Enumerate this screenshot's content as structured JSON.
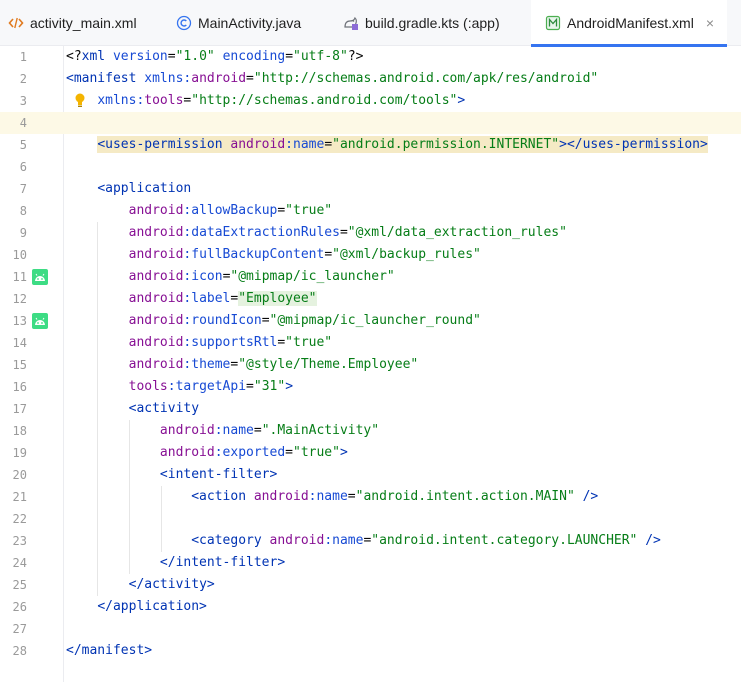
{
  "tabs": [
    {
      "label": "activity_main.xml",
      "icon": "xml-file-icon",
      "active": false
    },
    {
      "label": "MainActivity.java",
      "icon": "java-class-icon",
      "active": false
    },
    {
      "label": "build.gradle.kts (:app)",
      "icon": "gradle-file-icon",
      "active": false
    },
    {
      "label": "AndroidManifest.xml",
      "icon": "manifest-file-icon",
      "active": true
    }
  ],
  "close_glyph": "×",
  "editor": {
    "line_numbers": [
      "1",
      "2",
      "3",
      "4",
      "5",
      "6",
      "7",
      "8",
      "9",
      "10",
      "11",
      "12",
      "13",
      "14",
      "15",
      "16",
      "17",
      "18",
      "19",
      "20",
      "21",
      "22",
      "23",
      "24",
      "25",
      "26",
      "27",
      "28"
    ],
    "lines": [
      "<?xml version=\"1.0\" encoding=\"utf-8\"?>",
      "<manifest xmlns:android=\"http://schemas.android.com/apk/res/android\"",
      "    xmlns:tools=\"http://schemas.android.com/tools\">",
      "",
      "    <uses-permission android:name=\"android.permission.INTERNET\"></uses-permission>",
      "",
      "    <application",
      "        android:allowBackup=\"true\"",
      "        android:dataExtractionRules=\"@xml/data_extraction_rules\"",
      "        android:fullBackupContent=\"@xml/backup_rules\"",
      "        android:icon=\"@mipmap/ic_launcher\"",
      "        android:label=\"Employee\"",
      "        android:roundIcon=\"@mipmap/ic_launcher_round\"",
      "        android:supportsRtl=\"true\"",
      "        android:theme=\"@style/Theme.Employee\"",
      "        tools:targetApi=\"31\">",
      "        <activity",
      "            android:name=\".MainActivity\"",
      "            android:exported=\"true\">",
      "            <intent-filter>",
      "                <action android:name=\"android.intent.action.MAIN\" />",
      "",
      "                <category android:name=\"android.intent.category.LAUNCHER\" />",
      "            </intent-filter>",
      "        </activity>",
      "    </application>",
      "",
      "</manifest>"
    ],
    "caret_line": 4,
    "gutter_icons": [
      {
        "line": 11,
        "icon": "android-icon"
      },
      {
        "line": 13,
        "icon": "android-icon"
      }
    ],
    "intention_bulb": {
      "line": 3,
      "icon": "lightbulb-icon"
    }
  },
  "colors": {
    "tag": "#0033b3",
    "attribute": "#174ad4",
    "namespace": "#871094",
    "value": "#067d17",
    "accent": "#3574f0"
  }
}
